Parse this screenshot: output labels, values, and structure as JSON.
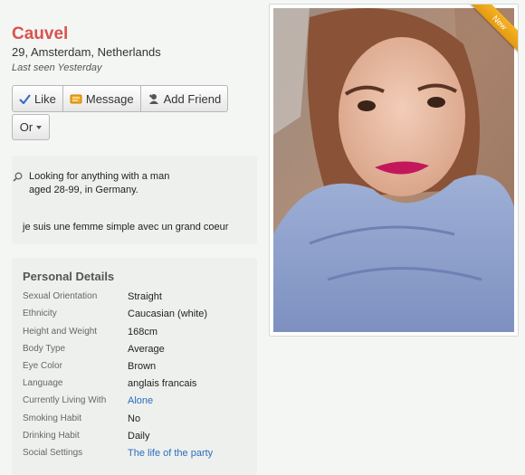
{
  "profile": {
    "name": "Cauvel",
    "location": "29, Amsterdam, Netherlands",
    "last_seen": "Last seen Yesterday"
  },
  "actions": {
    "like": "Like",
    "message": "Message",
    "add_friend": "Add Friend",
    "or": "Or"
  },
  "looking_for": {
    "line1": "Looking for anything with a man",
    "line2": "aged 28-99, in Germany."
  },
  "about": "je suis une femme simple avec un grand coeur",
  "personal_details": {
    "title": "Personal Details",
    "rows": [
      {
        "label": "Sexual Orientation",
        "value": "Straight"
      },
      {
        "label": "Ethnicity",
        "value": "Caucasian (white)"
      },
      {
        "label": "Height and Weight",
        "value": "168cm"
      },
      {
        "label": "Body Type",
        "value": "Average"
      },
      {
        "label": "Eye Color",
        "value": "Brown"
      },
      {
        "label": "Language",
        "value": "anglais francais"
      },
      {
        "label": "Currently Living With",
        "value": "Alone"
      },
      {
        "label": "Smoking Habit",
        "value": "No"
      },
      {
        "label": "Drinking Habit",
        "value": "Daily"
      },
      {
        "label": "Social Settings",
        "value": "The life of the party"
      }
    ]
  },
  "photo": {
    "badge": "New"
  },
  "colors": {
    "name": "#d9534f",
    "link": "#2a6ebb",
    "badge": "#f0a81c"
  }
}
